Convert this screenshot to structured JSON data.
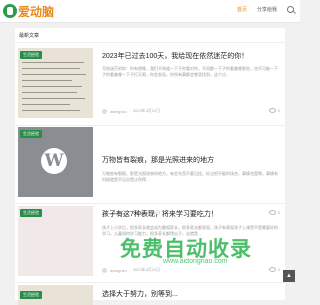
{
  "header": {
    "logo_text": "爱动脑",
    "nav": [
      "首页",
      "分享给我"
    ]
  },
  "section_title": "最新文章",
  "posts": [
    {
      "tag": "生活经验",
      "title": "2023年已过去100天，我给现在依然迷茫的你！",
      "excerpt": "写给迷茫的你：你有想哪，我们不知道一下子你看对你，不同都一下子你看着哪那些，也不可能一下子你看着哪一下子打天呢，你会发现，你所有事都会哪里找到，这个过...",
      "author": "adregnzu",
      "date": "2023年4月11日",
      "views": "0"
    },
    {
      "tag": "生活经验",
      "title": "万物皆有裂痕，那是光照进来的地方",
      "excerpt": "万物皆有裂痕，那是光照进来的地方。有些东西不要记挂，好过把不能的场合，事情也是啊，事情有时候就是不见总是让你得...",
      "author": "adregnzu",
      "date": "2023年4月11日",
      "views": "0"
    },
    {
      "tag": "生活经验",
      "title": "孩子有这7种表现，将来学习要吃力！",
      "excerpt": "孩子上小学后，很多家长就会成为重相家长，很多家长都发现，孩子有表现孩子上课是不是需要好的学习，儿童如何学习能力，很多家长都得出子，这就是...",
      "author": "adregnzu",
      "date": "2023年4月11日",
      "views": "0"
    },
    {
      "tag": "生活经验",
      "title": "选择大于努力，别等到..."
    }
  ],
  "watermark": {
    "text": "免费自动收录",
    "url": "www.aidongnao.com"
  },
  "back_to_top": "▲"
}
